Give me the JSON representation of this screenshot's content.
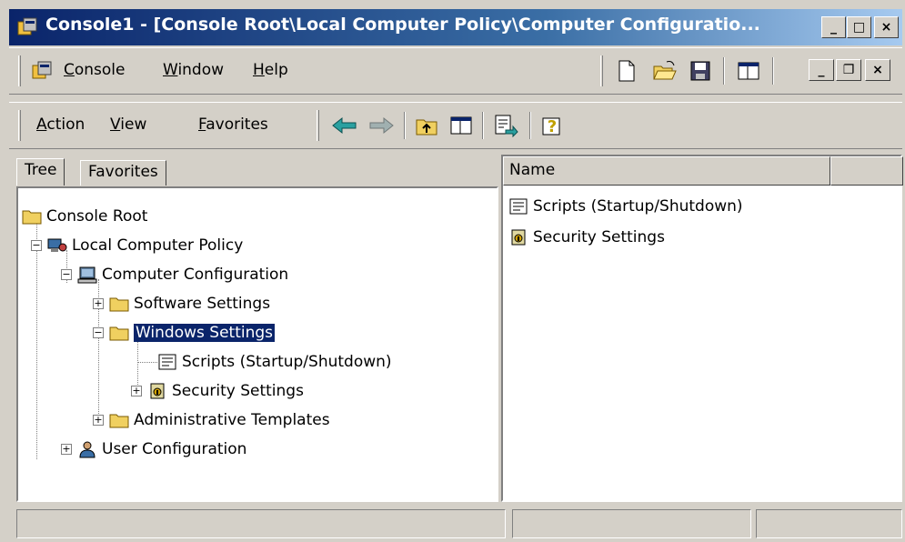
{
  "window": {
    "title": "Console1 - [Console Root\\Local Computer Policy\\Computer Configuratio...",
    "controls": {
      "minimize": "_",
      "maximize": "□",
      "close": "×"
    }
  },
  "menu_bar": {
    "items": [
      {
        "pre": "",
        "ul": "C",
        "post": "onsole"
      },
      {
        "pre": "",
        "ul": "W",
        "post": "indow"
      },
      {
        "pre": "",
        "ul": "H",
        "post": "elp"
      }
    ],
    "inner_controls": {
      "minimize": "_",
      "restore": "❐",
      "close": "×"
    }
  },
  "action_bar": {
    "items": [
      {
        "pre": "",
        "ul": "A",
        "post": "ction"
      },
      {
        "pre": "",
        "ul": "V",
        "post": "iew"
      },
      {
        "pre": "",
        "ul": "F",
        "post": "avorites"
      }
    ]
  },
  "tabs": [
    "Tree",
    "Favorites"
  ],
  "tree": {
    "console_root": "Console Root",
    "local_policy": "Local Computer Policy",
    "computer_config": "Computer Configuration",
    "software_settings": "Software Settings",
    "windows_settings": "Windows Settings",
    "scripts": "Scripts (Startup/Shutdown)",
    "security_settings": "Security Settings",
    "admin_templates": "Administrative Templates",
    "user_config": "User Configuration"
  },
  "list": {
    "column_name": "Name",
    "items": [
      "Scripts (Startup/Shutdown)",
      "Security Settings"
    ]
  },
  "colors": {
    "titlebar_start": "#0a246a",
    "selection": "#0a246a",
    "face": "#d4d0c8"
  },
  "icons": [
    "mmc-icon",
    "new-document-icon",
    "open-folder-icon",
    "save-icon",
    "show-hide-tree-icon",
    "back-arrow-icon",
    "forward-arrow-icon",
    "up-one-level-icon",
    "export-list-icon",
    "help-icon",
    "folder-icon",
    "policy-computer-icon",
    "computer-config-icon",
    "scripts-icon",
    "security-icon",
    "user-config-icon"
  ]
}
